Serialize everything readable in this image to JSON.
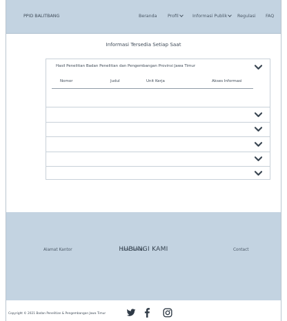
{
  "navbar": {
    "brand": "PPID BALITBANG",
    "items": [
      {
        "label": "Beranda",
        "has_caret": false
      },
      {
        "label": "Profil",
        "has_caret": true
      },
      {
        "label": "Informasi Publik",
        "has_caret": true
      },
      {
        "label": "Regulasi",
        "has_caret": false
      },
      {
        "label": "FAQ",
        "has_caret": false
      }
    ]
  },
  "main": {
    "title": "Informasi Tersedia Setiap Saat",
    "accordion": {
      "open_item_title": "Hasil Penelitian Badan Penelitian dan Pengembangan Provinsi Jawa Timur",
      "table_headers": [
        "Nomor",
        "Judul",
        "Unit Kerja",
        "Akses Informasi"
      ],
      "collapsed_count": 5
    }
  },
  "footer": {
    "title": "HUBUNGI KAMI",
    "columns": [
      "Alamat Kantor",
      "Link Terkait",
      "Contact"
    ],
    "copyright": "Copyright © 2021 Badan Penelitian & Pengembangan Jawa Timur",
    "social_icons": [
      "twitter-icon",
      "facebook-icon",
      "instagram-icon"
    ]
  },
  "colors": {
    "header_bg": "#c3d3e1",
    "footer_bg": "#c3d3e1",
    "text": "#3e4a57",
    "border": "#c7d0d8"
  }
}
